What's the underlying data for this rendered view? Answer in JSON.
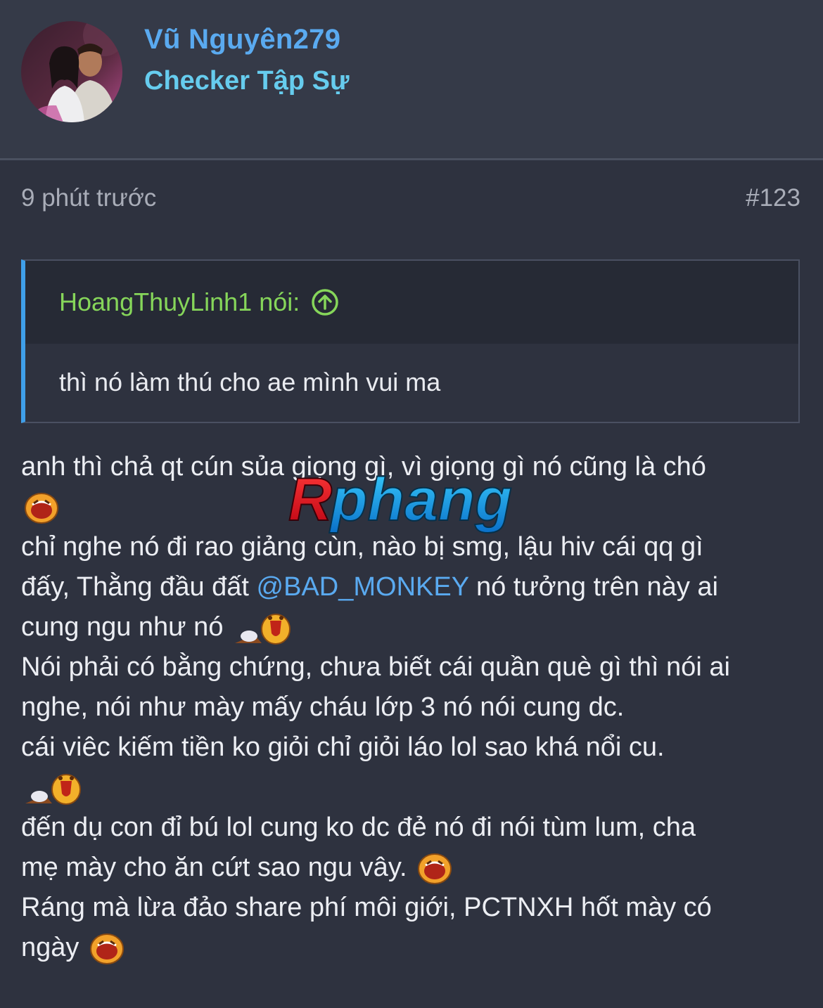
{
  "user": {
    "name": "Vũ Nguyên279",
    "title": "Checker Tập Sự"
  },
  "post": {
    "time": "9 phút trước",
    "number": "#123"
  },
  "quote": {
    "author_label": "HoangThuyLinh1 nói:",
    "text": "thì nó làm thú cho ae mình vui ma"
  },
  "body": {
    "l1": "anh thì chả qt cún sủa giọng gì, vì giọng gì nó cũng là chó",
    "l2a": "chỉ nghe nó đi rao giảng cùn, nào bị smg, lậu hiv cái qq gì",
    "l2b": "đấy, Thằng đầu đất ",
    "mention": "@BAD_MONKEY",
    "l2c": " nó tưởng trên này ai",
    "l2d": "cung ngu như nó ",
    "l3a": "Nói phải có bằng chứng, chưa biết cái quần què gì thì nói ai",
    "l3b": "nghe, nói như mày mấy cháu lớp 3 nó nói cung dc.",
    "l4": "cái viêc kiếm tiền ko giỏi chỉ giỏi láo lol sao khá nổi cu.",
    "l5a": "đến dụ con đỉ bú lol cung ko dc đẻ nó đi nói tùm lum, cha",
    "l5b": "mẹ mày cho ăn cứt sao ngu vây. ",
    "l6a": "Ráng mà lừa đảo share phí môi giới, PCTNXH hốt mày có",
    "l6b": "ngày "
  },
  "watermark": {
    "text": "Rphang"
  },
  "colors": {
    "background": "#2e323f",
    "username": "#5aaaf0",
    "user_title": "#66ccee",
    "quote_author": "#86d65a",
    "quote_border": "#3f9fe9",
    "mention": "#5aaaf0"
  },
  "icons": {
    "quote_jump": "arrow-up-circle-icon",
    "emoji_laugh": "laughing-emoji-icon",
    "emoji_lol": "rolling-laugh-emoji-icon"
  }
}
